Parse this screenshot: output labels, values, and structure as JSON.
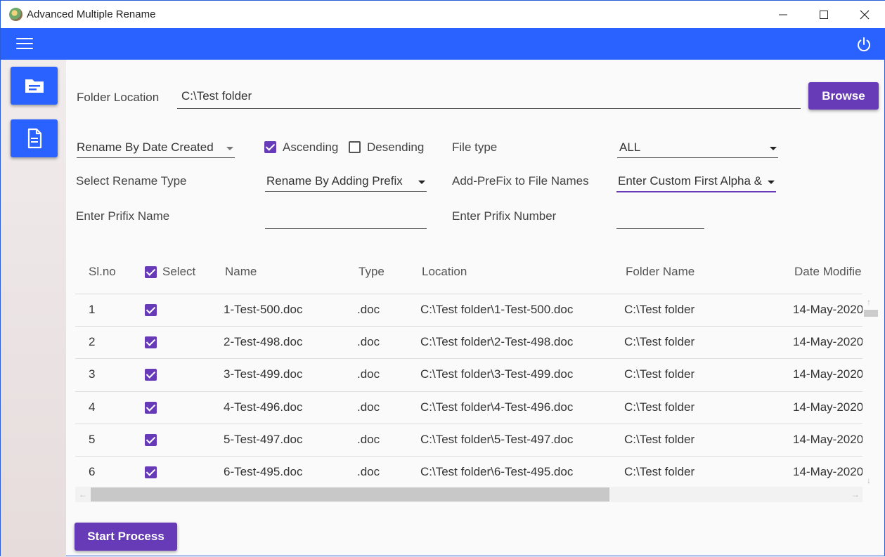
{
  "window": {
    "title": "Advanced Multiple Rename"
  },
  "appbar": {
    "menu_icon": "hamburger-menu-icon",
    "power_icon": "power-icon"
  },
  "rail": {
    "items": [
      "folder-card-icon",
      "document-icon"
    ]
  },
  "form": {
    "folder_label": "Folder Location",
    "folder_value": "C:\\Test folder",
    "browse_label": "Browse",
    "sort_by": "Rename By Date Created",
    "ascending_label": "Ascending",
    "ascending_checked": true,
    "descending_label": "Desending",
    "descending_checked": false,
    "file_type_label": "File type",
    "file_type_value": "ALL",
    "rename_type_label": "Select Rename Type",
    "rename_type_value": "Rename By Adding Prefix",
    "add_prefix_label": "Add-PreFix to File Names",
    "add_prefix_value": "Enter Custom First Alpha &",
    "prefix_name_label": "Enter Prifix Name",
    "prefix_name_value": "",
    "prefix_number_label": "Enter Prifix Number",
    "prefix_number_value": ""
  },
  "table": {
    "headers": {
      "slno": "Sl.no",
      "select": "Select",
      "name": "Name",
      "type": "Type",
      "location": "Location",
      "folder": "Folder Name",
      "date": "Date Modifie"
    },
    "select_all_checked": true,
    "rows": [
      {
        "slno": "1",
        "checked": true,
        "name": "1-Test-500.doc",
        "type": ".doc",
        "location": "C:\\Test folder\\1-Test-500.doc",
        "folder": "C:\\Test folder",
        "date": "14-May-2020"
      },
      {
        "slno": "2",
        "checked": true,
        "name": "2-Test-498.doc",
        "type": ".doc",
        "location": "C:\\Test folder\\2-Test-498.doc",
        "folder": "C:\\Test folder",
        "date": "14-May-2020"
      },
      {
        "slno": "3",
        "checked": true,
        "name": "3-Test-499.doc",
        "type": ".doc",
        "location": "C:\\Test folder\\3-Test-499.doc",
        "folder": "C:\\Test folder",
        "date": "14-May-2020"
      },
      {
        "slno": "4",
        "checked": true,
        "name": "4-Test-496.doc",
        "type": ".doc",
        "location": "C:\\Test folder\\4-Test-496.doc",
        "folder": "C:\\Test folder",
        "date": "14-May-2020"
      },
      {
        "slno": "5",
        "checked": true,
        "name": "5-Test-497.doc",
        "type": ".doc",
        "location": "C:\\Test folder\\5-Test-497.doc",
        "folder": "C:\\Test folder",
        "date": "14-May-2020"
      },
      {
        "slno": "6",
        "checked": true,
        "name": "6-Test-495.doc",
        "type": ".doc",
        "location": "C:\\Test folder\\6-Test-495.doc",
        "folder": "C:\\Test folder",
        "date": "14-May-2020"
      }
    ]
  },
  "actions": {
    "start_label": "Start Process"
  },
  "colors": {
    "appbar": "#2962ff",
    "accent": "#673ab7"
  }
}
